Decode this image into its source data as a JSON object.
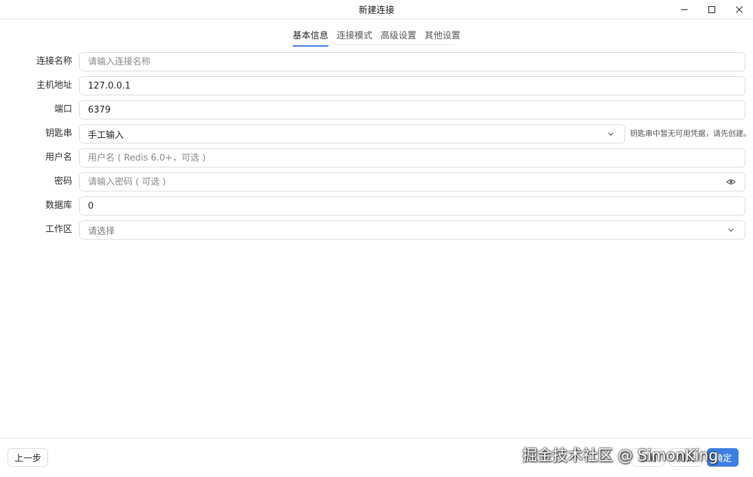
{
  "window": {
    "title": "新建连接"
  },
  "tabs": [
    {
      "label": "基本信息",
      "active": true
    },
    {
      "label": "连接模式",
      "active": false
    },
    {
      "label": "高级设置",
      "active": false
    },
    {
      "label": "其他设置",
      "active": false
    }
  ],
  "form": {
    "name": {
      "label": "连接名称",
      "value": "",
      "placeholder": "请输入连接名称"
    },
    "host": {
      "label": "主机地址",
      "value": "127.0.0.1"
    },
    "port": {
      "label": "端口",
      "value": "6379"
    },
    "keychain": {
      "label": "钥匙串",
      "selected": "手工输入",
      "hint": "钥匙串中暂无可用凭据，请先创建。"
    },
    "username": {
      "label": "用户名",
      "value": "",
      "placeholder": "用户名 ( Redis 6.0+，可选 )"
    },
    "password": {
      "label": "密码",
      "value": "",
      "placeholder": "请输入密码 ( 可选 )"
    },
    "database": {
      "label": "数据库",
      "value": "0"
    },
    "workspace": {
      "label": "工作区",
      "placeholder": "请选择"
    }
  },
  "footer": {
    "prev_label": "上一步",
    "cancel_label": "取消",
    "test_label": "测试",
    "ok_label": "确定"
  },
  "watermark": "掘金技术社区 @ SimonKing",
  "colors": {
    "accent": "#3d7fe0",
    "border": "#dcdcdc"
  }
}
